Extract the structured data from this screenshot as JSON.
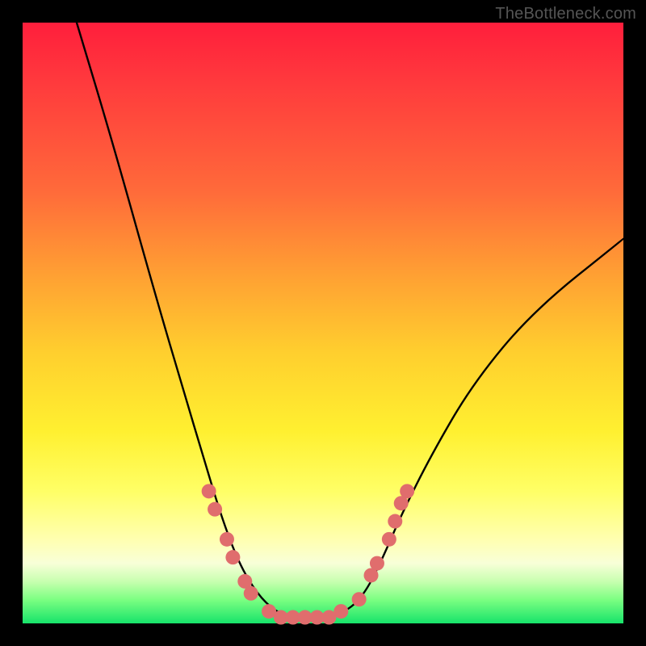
{
  "watermark": "TheBottleneck.com",
  "colors": {
    "background_frame": "#000000",
    "gradient_stops": [
      "#ff1e3c",
      "#ff6a3a",
      "#ffcf2e",
      "#ffff66",
      "#17e36a"
    ],
    "curve_stroke": "#000000",
    "dot_fill": "#e06d6d"
  },
  "chart_data": {
    "type": "line",
    "title": "",
    "xlabel": "",
    "ylabel": "",
    "xlim": [
      0,
      100
    ],
    "ylim": [
      0,
      100
    ],
    "legend": false,
    "grid": false,
    "description": "V-shaped bottleneck curve. Background is a vertical heat gradient (red high = big bottleneck, green low = balanced). Curve descends steeply from top-left, flattens to a small plateau at the bottom center, then rises to mid-right. Salmon dots mark sample points along the lower part of both arms and the plateau.",
    "series": [
      {
        "name": "bottleneck-curve",
        "points": [
          {
            "x": 9,
            "y": 100
          },
          {
            "x": 15,
            "y": 80
          },
          {
            "x": 22,
            "y": 55
          },
          {
            "x": 27,
            "y": 38
          },
          {
            "x": 30,
            "y": 28
          },
          {
            "x": 33,
            "y": 18
          },
          {
            "x": 36,
            "y": 10
          },
          {
            "x": 39,
            "y": 5
          },
          {
            "x": 42,
            "y": 2
          },
          {
            "x": 45,
            "y": 1
          },
          {
            "x": 50,
            "y": 1
          },
          {
            "x": 54,
            "y": 2
          },
          {
            "x": 57,
            "y": 5
          },
          {
            "x": 60,
            "y": 11
          },
          {
            "x": 63,
            "y": 18
          },
          {
            "x": 68,
            "y": 28
          },
          {
            "x": 75,
            "y": 40
          },
          {
            "x": 85,
            "y": 52
          },
          {
            "x": 100,
            "y": 64
          }
        ]
      }
    ],
    "markers": [
      {
        "x": 31,
        "y": 22
      },
      {
        "x": 32,
        "y": 19
      },
      {
        "x": 34,
        "y": 14
      },
      {
        "x": 35,
        "y": 11
      },
      {
        "x": 37,
        "y": 7
      },
      {
        "x": 38,
        "y": 5
      },
      {
        "x": 41,
        "y": 2
      },
      {
        "x": 43,
        "y": 1
      },
      {
        "x": 45,
        "y": 1
      },
      {
        "x": 47,
        "y": 1
      },
      {
        "x": 49,
        "y": 1
      },
      {
        "x": 51,
        "y": 1
      },
      {
        "x": 53,
        "y": 2
      },
      {
        "x": 56,
        "y": 4
      },
      {
        "x": 58,
        "y": 8
      },
      {
        "x": 59,
        "y": 10
      },
      {
        "x": 61,
        "y": 14
      },
      {
        "x": 62,
        "y": 17
      },
      {
        "x": 63,
        "y": 20
      },
      {
        "x": 64,
        "y": 22
      }
    ]
  }
}
